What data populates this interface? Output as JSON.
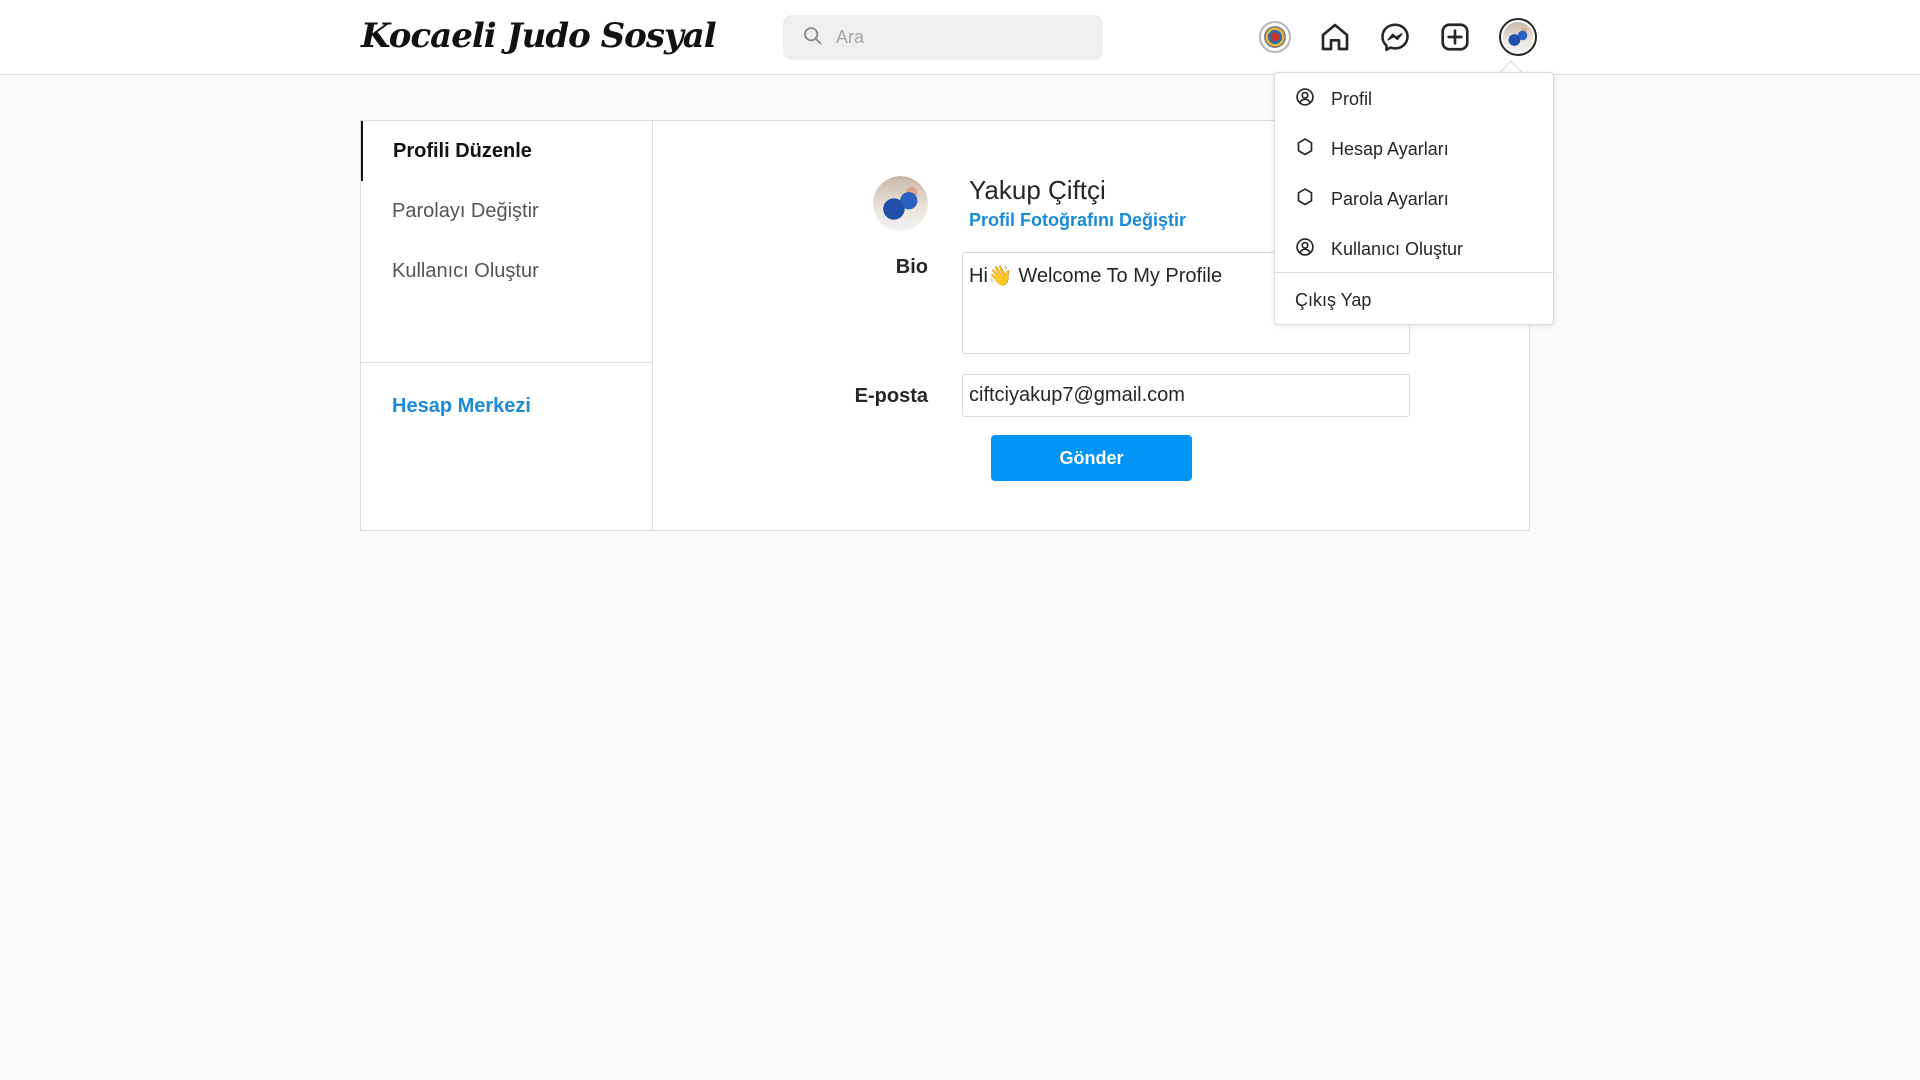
{
  "header": {
    "brand": "Kocaeli Judo Sosyal",
    "search": {
      "placeholder": "Ara",
      "value": ""
    },
    "icons": [
      "club-logo",
      "home-icon",
      "messenger-icon",
      "new-post-icon",
      "profile-avatar"
    ]
  },
  "menu": {
    "items": [
      {
        "label": "Profil",
        "icon": "user-circle-icon"
      },
      {
        "label": "Hesap Ayarları",
        "icon": "gear-icon"
      },
      {
        "label": "Parola Ayarları",
        "icon": "gear-icon"
      },
      {
        "label": "Kullanıcı Oluştur",
        "icon": "user-circle-icon"
      }
    ],
    "logout": "Çıkış Yap"
  },
  "sidebar": {
    "items": [
      {
        "label": "Profili Düzenle",
        "active": true
      },
      {
        "label": "Parolayı Değiştir",
        "active": false
      },
      {
        "label": "Kullanıcı Oluştur",
        "active": false
      }
    ],
    "account_center": "Hesap Merkezi"
  },
  "profile": {
    "name": "Yakup Çiftçi",
    "change_photo": "Profil Fotoğrafını Değiştir"
  },
  "form": {
    "bio_label": "Bio",
    "bio_value": "Hi👋 Welcome To My Profile",
    "email_label": "E-posta",
    "email_value": "ciftciyakup7@gmail.com",
    "submit_label": "Gönder"
  },
  "colors": {
    "accent": "#0095f6",
    "link": "#1a8bd8",
    "border": "#dbdbdb",
    "background": "#fafafa"
  }
}
